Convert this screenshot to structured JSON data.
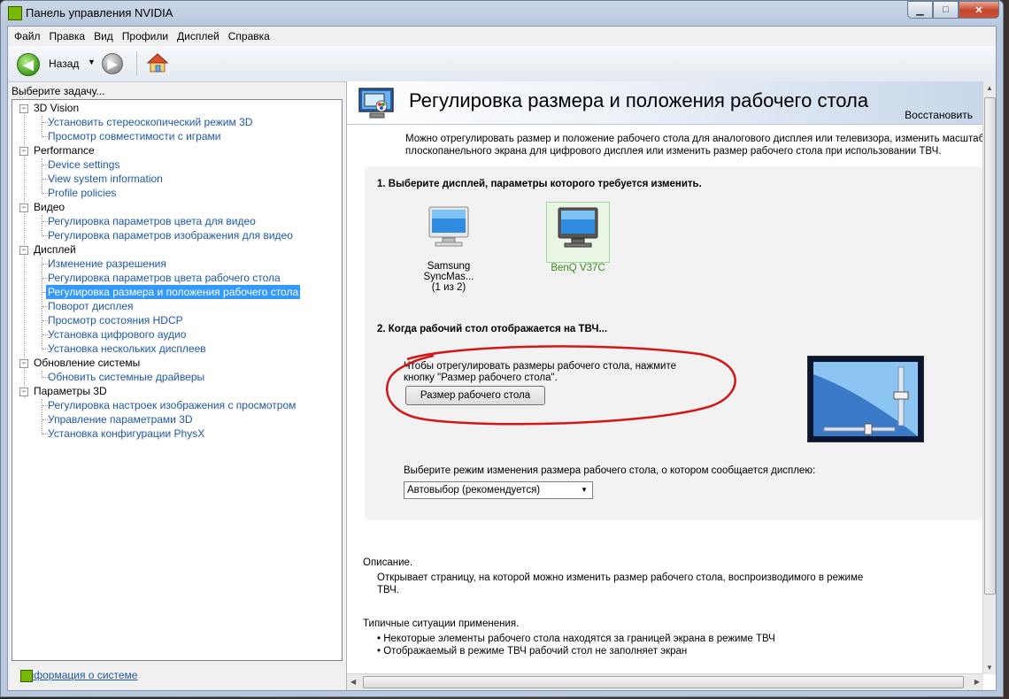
{
  "window": {
    "title": "Панель управления NVIDIA"
  },
  "menu": [
    "Файл",
    "Правка",
    "Вид",
    "Профили",
    "Дисплей",
    "Справка"
  ],
  "toolbar": {
    "back_label": "Назад"
  },
  "left": {
    "task_label": "Выберите задачу...",
    "tree": [
      {
        "label": "3D Vision",
        "children": [
          "Установить стереоскопический режим 3D",
          "Просмотр совместимости с играми"
        ]
      },
      {
        "label": "Performance",
        "children": [
          "Device settings",
          "View system information",
          "Profile policies"
        ]
      },
      {
        "label": "Видео",
        "children": [
          "Регулировка параметров цвета для видео",
          "Регулировка параметров изображения для видео"
        ]
      },
      {
        "label": "Дисплей",
        "children": [
          "Изменение разрешения",
          "Регулировка параметров цвета рабочего стола",
          "Регулировка размера и положения рабочего стола",
          "Поворот дисплея",
          "Просмотр состояния HDCP",
          "Установка цифрового аудио",
          "Установка нескольких дисплеев"
        ]
      },
      {
        "label": "Обновление системы",
        "children": [
          "Обновить системные драйверы"
        ]
      },
      {
        "label": "Параметры 3D",
        "children": [
          "Регулировка настроек изображения с просмотром",
          "Управление параметрами 3D",
          "Установка конфигурации PhysX"
        ]
      }
    ],
    "selected": "Регулировка размера и положения рабочего стола",
    "system_info_link": "Информация о системе"
  },
  "page": {
    "title": "Регулировка размера и положения рабочего стола",
    "restore": "Восстановить",
    "intro": "Можно отрегулировать размер и положение рабочего стола для аналогового дисплея или телевизора, изменить масштабирова плоскопанельного экрана для цифрового дисплея или изменить размер рабочего стола при использовании ТВЧ.",
    "step1": "1. Выберите дисплей, параметры которого требуется изменить.",
    "displays": [
      {
        "name": "Samsung SyncMas...",
        "sub": "(1 из 2)",
        "selected": false
      },
      {
        "name": "BenQ V37C",
        "sub": "",
        "selected": true
      }
    ],
    "step2": "2. Когда рабочий стол отображается на ТВЧ...",
    "step2_text": "Чтобы отрегулировать размеры рабочего стола, нажмите кнопку \"Размер рабочего стола\".",
    "size_button": "Размер рабочего стола",
    "mode_label": "Выберите режим изменения размера рабочего стола, о котором сообщается дисплею:",
    "mode_value": "Автовыбор (рекомендуется)",
    "desc_heading": "Описание.",
    "desc_text": "Открывает страницу, на которой можно изменить размер рабочего стола, воспроизводимого в режиме ТВЧ.",
    "usage_heading": "Типичные ситуации применения.",
    "usage_items": [
      "Некоторые элементы рабочего стола находятся за границей экрана в режиме ТВЧ",
      "Отображаемый в режиме ТВЧ рабочий стол не заполняет экран"
    ]
  },
  "colors": {
    "accent": "#76b900",
    "link": "#2057a6",
    "selection": "#3399ff",
    "annotation": "#d01818"
  }
}
